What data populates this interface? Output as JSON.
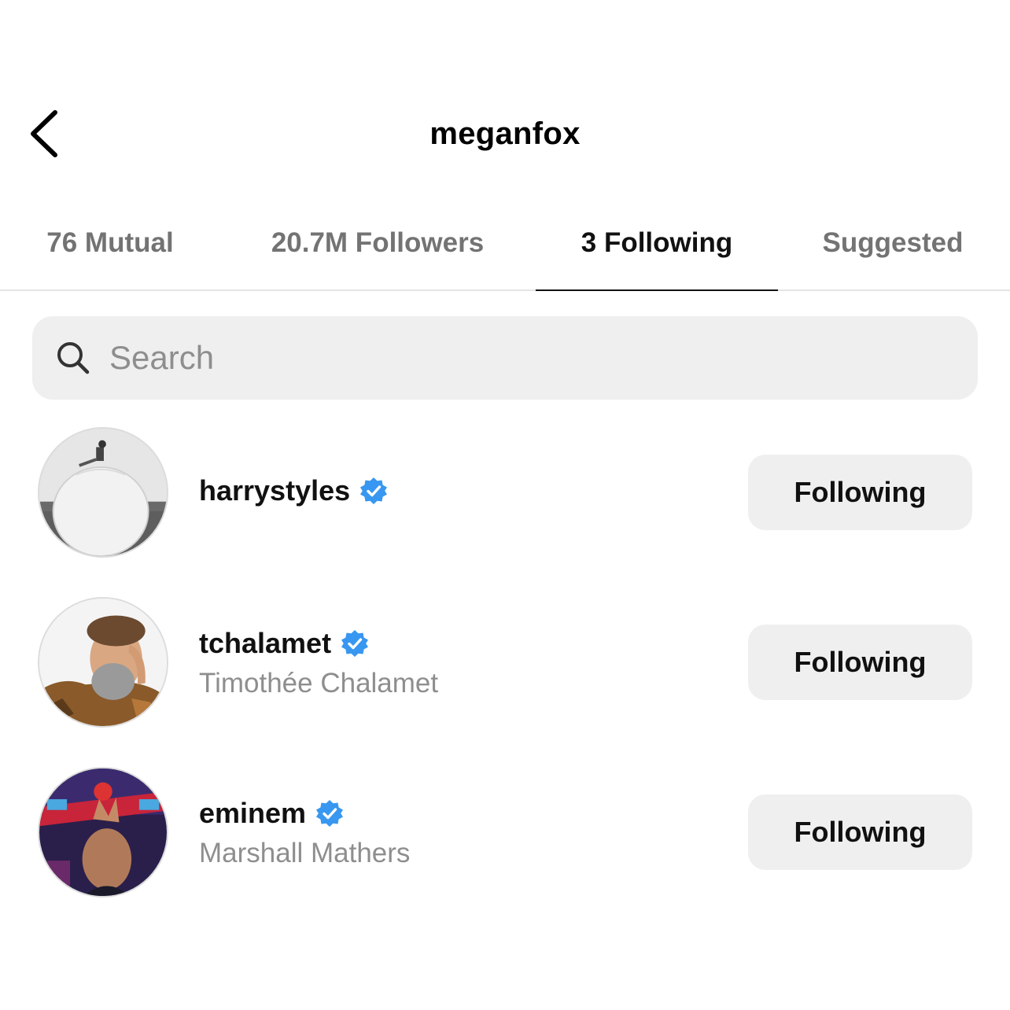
{
  "header": {
    "title": "meganfox"
  },
  "tabs": [
    {
      "label": "76 Mutual",
      "active": false
    },
    {
      "label": "20.7M Followers",
      "active": false
    },
    {
      "label": "3 Following",
      "active": true
    },
    {
      "label": "Suggested",
      "active": false
    }
  ],
  "search": {
    "placeholder": "Search",
    "value": ""
  },
  "list": [
    {
      "username": "harrystyles",
      "full_name": "",
      "verified": true,
      "button_label": "Following"
    },
    {
      "username": "tchalamet",
      "full_name": "Timothée Chalamet",
      "verified": true,
      "button_label": "Following"
    },
    {
      "username": "eminem",
      "full_name": "Marshall Mathers",
      "verified": true,
      "button_label": "Following"
    }
  ],
  "colors": {
    "verified": "#3897f0",
    "button_bg": "#efefef",
    "muted_text": "#8e8e8e"
  }
}
